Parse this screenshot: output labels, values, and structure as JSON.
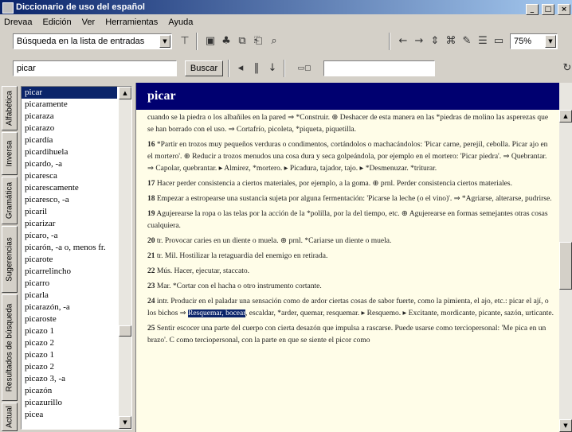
{
  "window": {
    "title": "Diccionario de uso del español",
    "controls": [
      "minimize-icon",
      "maximize-icon",
      "close-icon"
    ]
  },
  "menu": [
    "Drevaa",
    "Edición",
    "Ver",
    "Herramientas",
    "Ayuda"
  ],
  "toolbar1": {
    "search_mode": "Búsqueda en la lista de entradas",
    "zoom": "75%"
  },
  "toolbar2": {
    "search_value": "picar",
    "search_button": "Buscar"
  },
  "left_tabs": [
    "Alfabética",
    "Inversa",
    "Gramática",
    "Sugerencias",
    "Resultados de búsqueda",
    "Actual"
  ],
  "word_list": [
    "picar",
    "picaramente",
    "picaraza",
    "picarazo",
    "picardía",
    "picardihuela",
    "picardo, -a",
    "picaresca",
    "picarescamente",
    "picaresco, -a",
    "picaril",
    "picarizar",
    "pícaro, -a",
    "picarón, -a o, menos fr.",
    "picarote",
    "picarrelincho",
    "picarro",
    "picarla",
    "picarazón, -a",
    "picaroste",
    "picazo 1",
    "picazo 2",
    "picazo 1",
    "picazo 2",
    "picazo 3, -a",
    "picazón",
    "picazurillo",
    "picea"
  ],
  "headword": "picar",
  "paragraphs": [
    {
      "num": "",
      "text": "cuando se la piedra o los albañiles en la pared ⇒ *Construir. ⊕ Deshacer de esta manera en las *piedras de molino las asperezas que se han borrado con el uso. ⇒ Cortafrío, picoleta, *piqueta, piquetilla."
    },
    {
      "num": "16",
      "text": "*Partir en trozos muy pequeños verduras o condimentos, cortándolos o machacándolos: 'Picar carne, perejil, cebolla. Picar ajo en el mortero'. ⊕ Reducir a trozos menudos una cosa dura y seca golpeándola, por ejemplo en el mortero: 'Picar piedra'. ⇒ Quebrantar. ⇒ Capolar, quebrantar. ▸ Almirez, *mortero. ▸ Picadura, tajador, tajo. ▸ *Desmenuzar. *triturar."
    },
    {
      "num": "17",
      "text": "Hacer perder consistencia a ciertos materiales, por ejemplo, a la goma. ⊕ prnl. Perder consistencia ciertos materiales."
    },
    {
      "num": "18",
      "text": "Empezar a estropearse una sustancia sujeta por alguna fermentación: 'Picarse la leche (o el vino)'. ⇒ *Agriarse, alterarse, pudrirse."
    },
    {
      "num": "19",
      "text": "Agujerearse la ropa o las telas por la acción de la *polilla, por la del tiempo, etc. ⊕ Agujerearse en formas semejantes otras cosas cualquiera."
    },
    {
      "num": "20",
      "text": "tr. Provocar caries en un diente o muela. ⊕ prnl. *Cariarse un diente o muela."
    },
    {
      "num": "21",
      "text": "tr. Mil. Hostilizar la retaguardia del enemigo en retirada."
    },
    {
      "num": "22",
      "text": "Mús. Hacer, ejecutar, staccato."
    },
    {
      "num": "23",
      "text": "Mar. *Cortar con el hacha o otro instrumento cortante."
    },
    {
      "num": "24",
      "text": "intr. Producir en el paladar una sensación como de ardor ciertas cosas de sabor fuerte, como la pimienta, el ajo, etc.: picar el ají, o los bichos ⇒ Resquemar, bocear, escaldar, *arder, quemar, resquemar. ▸ Resquemo. ▸ Excitante, mordicante, picante, sazón, urticante."
    },
    {
      "num": "25",
      "text": "Sentir escocer una parte del cuerpo con cierta desazón que impulsa a rascarse. Puede usarse como terciopersonal: 'Me pica en un brazo'. C como terciopersonal, con la parte en que se siente el picor como"
    }
  ],
  "highlight": "Resquemar, bocear"
}
